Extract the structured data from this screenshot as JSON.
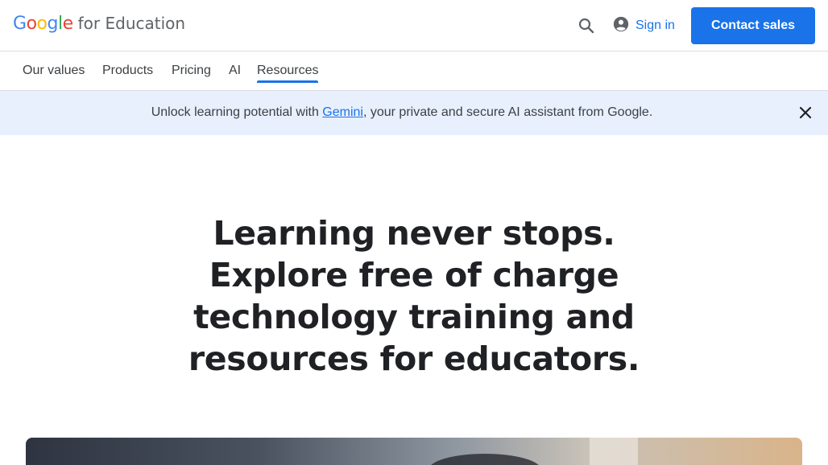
{
  "header": {
    "logo_google": "Google",
    "logo_suffix": "for Education",
    "signin_label": "Sign in",
    "contact_label": "Contact sales"
  },
  "nav": {
    "items": [
      {
        "label": "Our values"
      },
      {
        "label": "Products"
      },
      {
        "label": "Pricing"
      },
      {
        "label": "AI"
      },
      {
        "label": "Resources"
      }
    ],
    "active": "Resources"
  },
  "banner": {
    "prefix": "Unlock learning potential with ",
    "link": "Gemini",
    "suffix": ", your private and secure AI assistant from Google."
  },
  "hero": {
    "lines": [
      "Learning never stops.",
      "Explore free of charge",
      "technology training and",
      "resources for educators."
    ]
  },
  "colors": {
    "accent": "#1a73e8",
    "banner_bg": "#e8f0fe",
    "text": "#202124"
  }
}
